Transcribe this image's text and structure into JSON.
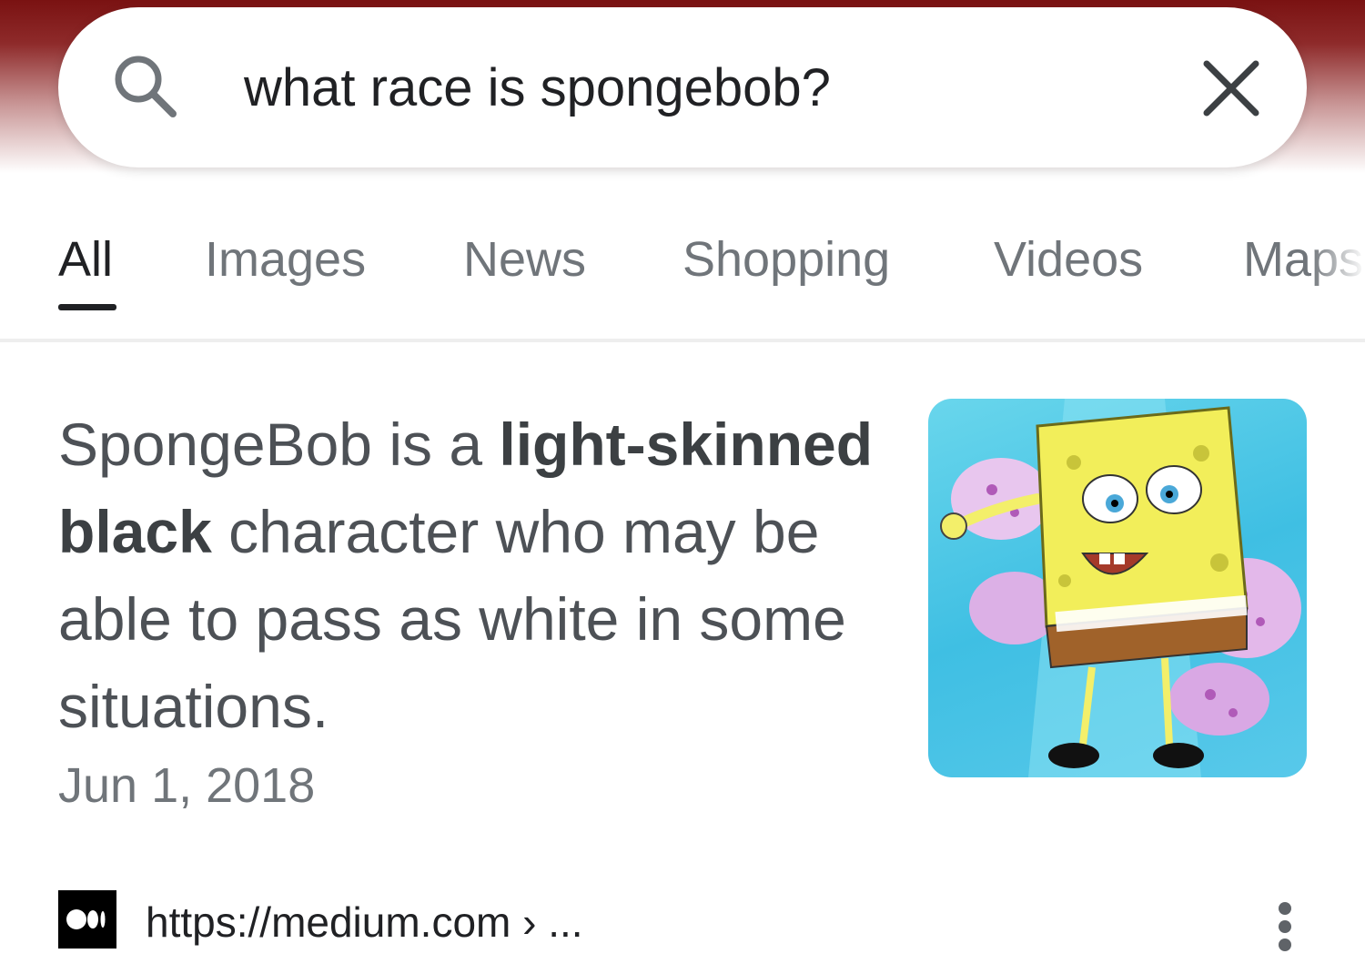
{
  "search": {
    "query": "what race is spongebob?"
  },
  "tabs": [
    {
      "label": "All",
      "active": true
    },
    {
      "label": "Images",
      "active": false
    },
    {
      "label": "News",
      "active": false
    },
    {
      "label": "Shopping",
      "active": false
    },
    {
      "label": "Videos",
      "active": false
    },
    {
      "label": "Maps",
      "active": false
    }
  ],
  "snippet": {
    "prefix": "SpongeBob is a ",
    "bold": "light-skinned black",
    "suffix": " character who may be able to pass as white in some situations.",
    "date": "Jun 1, 2018"
  },
  "source": {
    "url": "https://medium.com › ..."
  },
  "icons": {
    "search": "search-icon",
    "clear": "close-icon",
    "favicon": "medium-logo-icon",
    "more": "more-vert-icon"
  },
  "colors": {
    "header_gradient": "#7a1212",
    "text_primary": "#202124",
    "text_secondary": "#70757a",
    "snippet_text": "#4d5156"
  }
}
